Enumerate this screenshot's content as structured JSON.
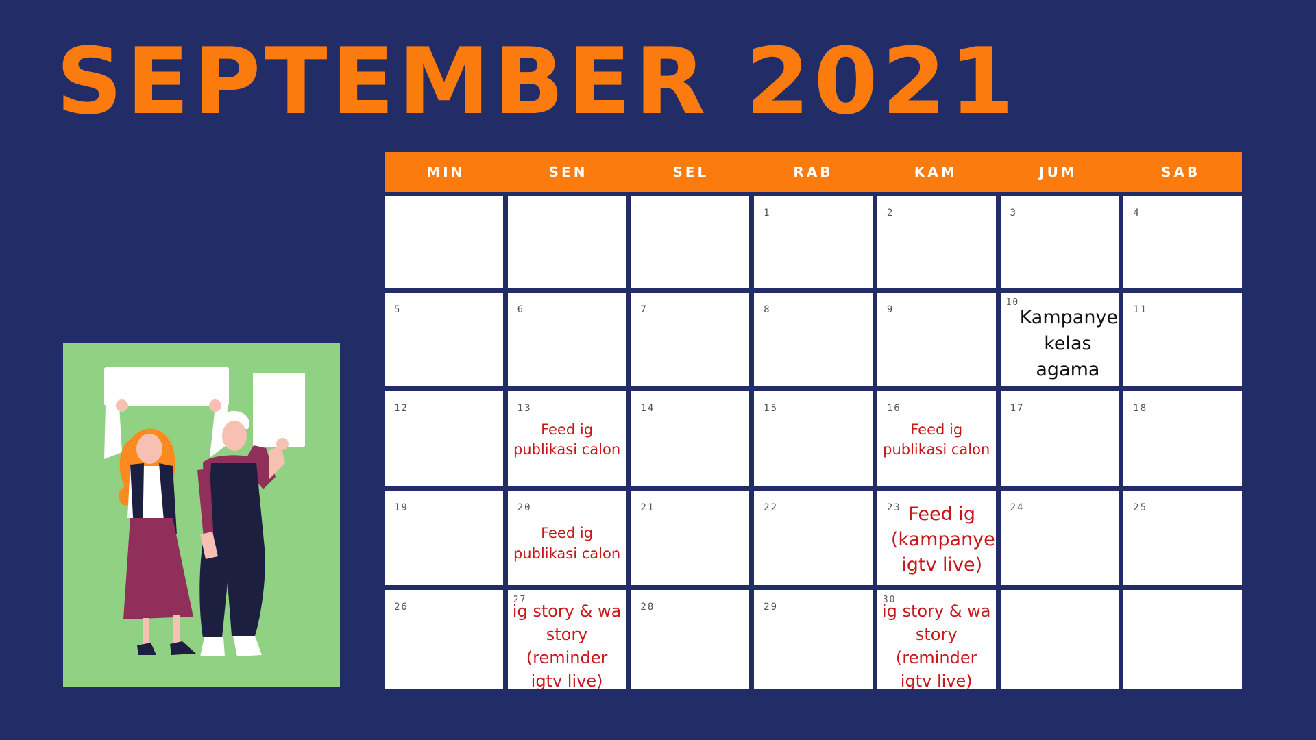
{
  "title": "SEPTEMBER 2021",
  "colors": {
    "background": "#222d68",
    "accent": "#fc7b0e",
    "cell": "#ffffff",
    "note_red": "#c8171b",
    "illustration_bg": "#90d183"
  },
  "weekdays": [
    "MIN",
    "SEN",
    "SEL",
    "RAB",
    "KAM",
    "JUM",
    "SAB"
  ],
  "weeks": [
    [
      {
        "day": "",
        "note": ""
      },
      {
        "day": "",
        "note": ""
      },
      {
        "day": "",
        "note": ""
      },
      {
        "day": "1",
        "note": ""
      },
      {
        "day": "2",
        "note": ""
      },
      {
        "day": "3",
        "note": ""
      },
      {
        "day": "4",
        "note": ""
      }
    ],
    [
      {
        "day": "5",
        "note": ""
      },
      {
        "day": "6",
        "note": ""
      },
      {
        "day": "7",
        "note": ""
      },
      {
        "day": "8",
        "note": ""
      },
      {
        "day": "9",
        "note": ""
      },
      {
        "day": "10",
        "note": "Kampanye\nkelas\nagama"
      },
      {
        "day": "11",
        "note": ""
      }
    ],
    [
      {
        "day": "12",
        "note": ""
      },
      {
        "day": "13",
        "note": "Feed ig\npublikasi calon"
      },
      {
        "day": "14",
        "note": ""
      },
      {
        "day": "15",
        "note": ""
      },
      {
        "day": "16",
        "note": "Feed ig\npublikasi calon"
      },
      {
        "day": "17",
        "note": ""
      },
      {
        "day": "18",
        "note": ""
      }
    ],
    [
      {
        "day": "19",
        "note": ""
      },
      {
        "day": "20",
        "note": "Feed ig\npublikasi calon"
      },
      {
        "day": "21",
        "note": ""
      },
      {
        "day": "22",
        "note": ""
      },
      {
        "day": "23",
        "note": "Feed ig\n(kampanye\nigtv live)"
      },
      {
        "day": "24",
        "note": ""
      },
      {
        "day": "25",
        "note": ""
      }
    ],
    [
      {
        "day": "26",
        "note": ""
      },
      {
        "day": "27",
        "note": "ig story & wa\nstory\n(reminder\nigtv live)"
      },
      {
        "day": "28",
        "note": ""
      },
      {
        "day": "29",
        "note": ""
      },
      {
        "day": "30",
        "note": "ig story & wa\nstory\n(reminder\nigtv live)"
      },
      {
        "day": "",
        "note": ""
      },
      {
        "day": "",
        "note": ""
      }
    ]
  ],
  "illustration": {
    "icon": "two-people-holding-signs-illustration"
  }
}
